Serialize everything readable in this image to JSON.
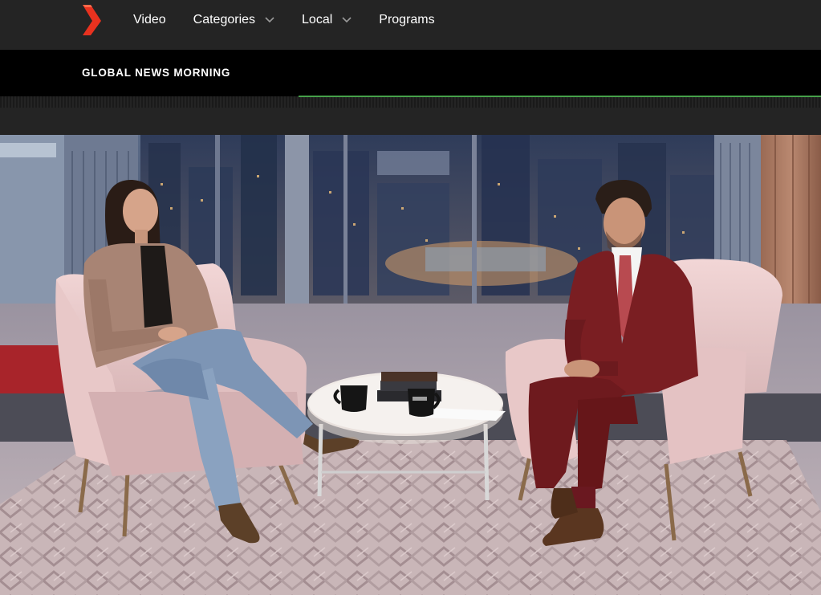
{
  "nav": {
    "logo_icon": "broadcaster-chevron-logo-icon",
    "logo_color": "#e8321f",
    "items": [
      {
        "label": "Video",
        "has_dropdown": false
      },
      {
        "label": "Categories",
        "has_dropdown": true
      },
      {
        "label": "Local",
        "has_dropdown": true
      },
      {
        "label": "Programs",
        "has_dropdown": false
      }
    ],
    "dropdown_icon": "chevron-down-icon"
  },
  "show": {
    "title": "GLOBAL NEWS MORNING",
    "progress_color": "#46a04a"
  },
  "video": {
    "icon": "video-frame",
    "scene": "Two people seated in pink armchairs on a studio set"
  }
}
